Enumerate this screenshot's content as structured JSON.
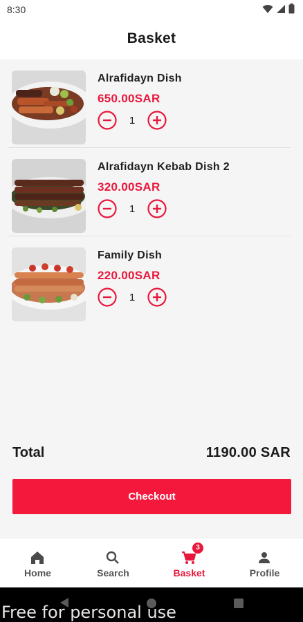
{
  "status_bar": {
    "time": "8:30",
    "icons": [
      "wifi-icon",
      "signal-icon",
      "battery-icon"
    ]
  },
  "header": {
    "title": "Basket"
  },
  "items": [
    {
      "name": "Alrafidayn Dish",
      "price": "650.00SAR",
      "quantity": "1"
    },
    {
      "name": "Alrafidayn Kebab Dish 2",
      "price": "320.00SAR",
      "quantity": "1"
    },
    {
      "name": "Family Dish",
      "price": "220.00SAR",
      "quantity": "1"
    }
  ],
  "summary": {
    "total_label": "Total",
    "total_value": "1190.00 SAR"
  },
  "checkout": {
    "label": "Checkout"
  },
  "nav": {
    "home": "Home",
    "search": "Search",
    "basket": "Basket",
    "basket_badge": "3",
    "profile": "Profile"
  },
  "watermark": "Free for personal use",
  "colors": {
    "accent": "#e8183c",
    "button": "#f5183d",
    "background": "#f5f5f5"
  }
}
